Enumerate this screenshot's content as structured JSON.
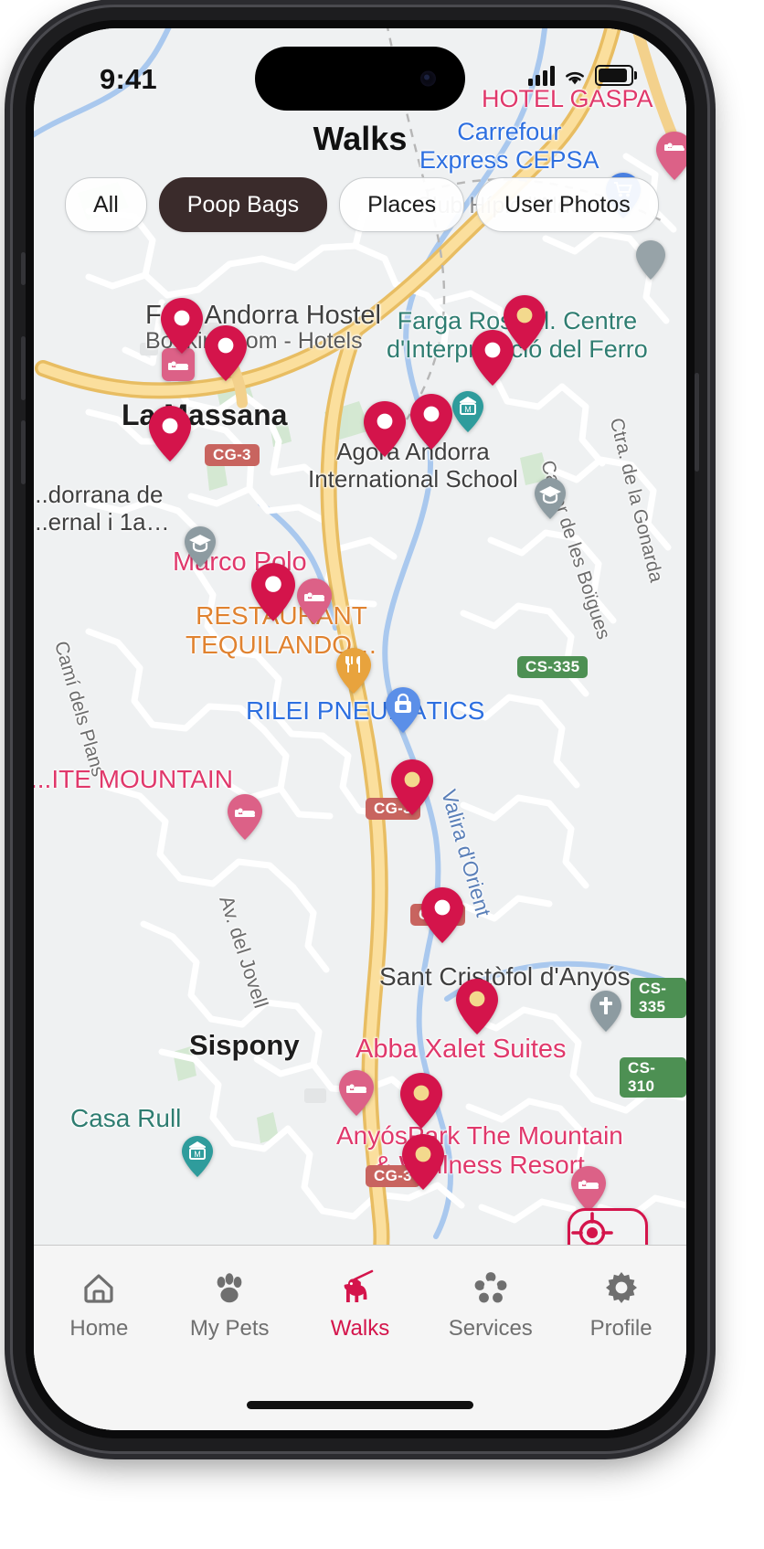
{
  "status": {
    "time": "9:41",
    "signal_icon": "cellular-bars-icon",
    "wifi_icon": "wifi-icon",
    "battery_icon": "battery-icon"
  },
  "header": {
    "title": "Walks"
  },
  "filters": {
    "chips": [
      {
        "label": "All",
        "active": false
      },
      {
        "label": "Poop Bags",
        "active": true
      },
      {
        "label": "Places",
        "active": false
      },
      {
        "label": "User Photos",
        "active": false
      }
    ]
  },
  "map": {
    "locate_button": {
      "name": "recenter-location-button",
      "icon": "crosshair-location-icon"
    },
    "labels": [
      {
        "text": "HOTEL GASPA",
        "kind": "hotel"
      },
      {
        "text": "Carrefour",
        "kind": "biz"
      },
      {
        "text": "Express CEPSA",
        "kind": "biz"
      },
      {
        "text": "Club Hípic l'Aldosa",
        "kind": "poi"
      },
      {
        "text": "Font Andorra Hostel",
        "kind": "poi"
      },
      {
        "text": "Booking.com - Hotels",
        "kind": "sub"
      },
      {
        "text": "Farga Rossell. Centre",
        "kind": "park"
      },
      {
        "text": "d'Interpretació del Ferro",
        "kind": "park"
      },
      {
        "text": "La Massana",
        "kind": "city"
      },
      {
        "text": "Agora Andorra",
        "kind": "poi"
      },
      {
        "text": "International School",
        "kind": "poi"
      },
      {
        "text": "CG-3",
        "kind": "shield-cg"
      },
      {
        "text": "...dorrana de",
        "kind": "poi"
      },
      {
        "text": "...ernal i 1a…",
        "kind": "poi"
      },
      {
        "text": "Marco Polo",
        "kind": "hotel"
      },
      {
        "text": "RESTAURANT",
        "kind": "food"
      },
      {
        "text": "TEQUILANDO…",
        "kind": "food"
      },
      {
        "text": "Carrer de les Boïgues",
        "kind": "road"
      },
      {
        "text": "Ctra. de la Gonarda",
        "kind": "road"
      },
      {
        "text": "CS-335",
        "kind": "shield-cs"
      },
      {
        "text": "RILEI PNEUMÀTICS",
        "kind": "biz"
      },
      {
        "text": "Camí dels Plans",
        "kind": "road"
      },
      {
        "text": "...ITE MOUNTAIN",
        "kind": "hotel"
      },
      {
        "text": "Valira d'Orient",
        "kind": "road"
      },
      {
        "text": "Av. del Jovell",
        "kind": "road"
      },
      {
        "text": "Sant Cristòfol d'Anyós",
        "kind": "poi"
      },
      {
        "text": "Sispony",
        "kind": "city"
      },
      {
        "text": "Abba Xalet Suites",
        "kind": "hotel"
      },
      {
        "text": "CS-310",
        "kind": "shield-cs"
      },
      {
        "text": "Casa Rull",
        "kind": "park"
      },
      {
        "text": "AnyósPark The Mountain",
        "kind": "hotel"
      },
      {
        "text": "& Wellness Resort",
        "kind": "hotel"
      }
    ],
    "marker_counts": {
      "poop_bag_pins": 17,
      "hotel_pins": 6,
      "poi_pins": 6
    },
    "colors": {
      "marker_red": "#d4144b",
      "hotel_pink": "#dc6187",
      "accent": "#d4144b",
      "road_yellow": "#f8d47e",
      "water_blue": "#a9c8ee",
      "map_bg": "#eff1f2"
    }
  },
  "tabbar": {
    "items": [
      {
        "label": "Home",
        "icon": "home-icon",
        "active": false
      },
      {
        "label": "My Pets",
        "icon": "paw-icon",
        "active": false
      },
      {
        "label": "Walks",
        "icon": "dog-walk-icon",
        "active": true
      },
      {
        "label": "Services",
        "icon": "pet-services-icon",
        "active": false
      },
      {
        "label": "Profile",
        "icon": "gear-icon",
        "active": false
      }
    ]
  }
}
